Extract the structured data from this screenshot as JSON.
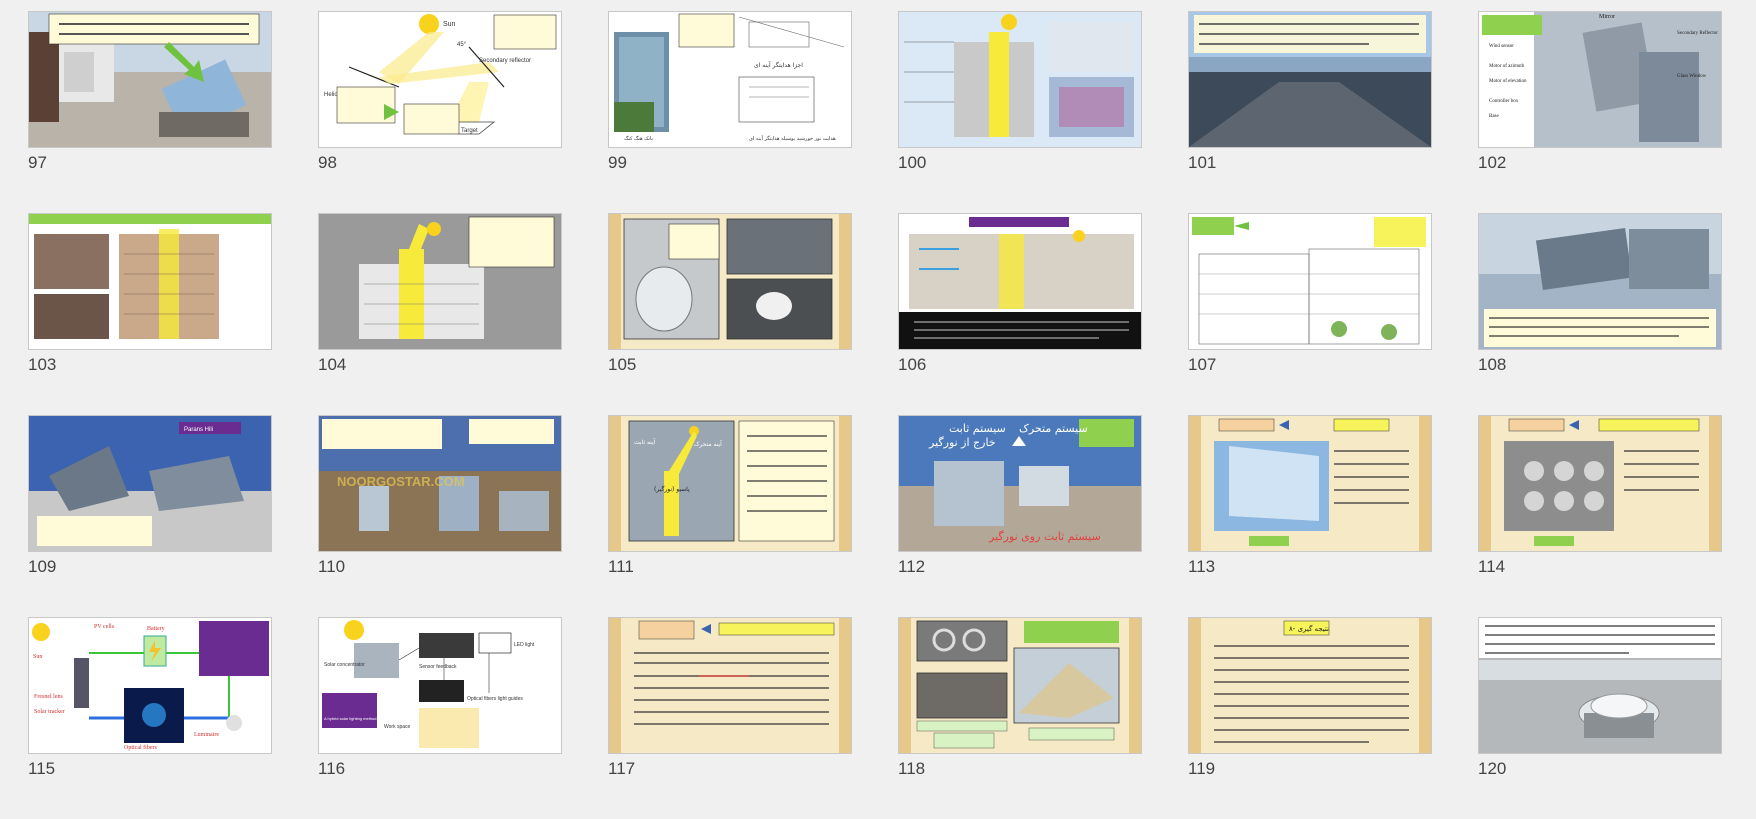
{
  "slides": [
    {
      "num": "97",
      "kind": "roof-heliostat"
    },
    {
      "num": "98",
      "kind": "diagram-sun",
      "labels": [
        "Sun",
        "Heliostat",
        "Secondary reflector",
        "Target",
        "45°"
      ]
    },
    {
      "num": "99",
      "kind": "building-drawing",
      "labels": [
        "اجزا هدایتگر آینه ای",
        "بانک هنگ کنگ",
        "هدایت نور خورشید بوسیله هدایتگر آینه ای"
      ]
    },
    {
      "num": "100",
      "kind": "diagram-building"
    },
    {
      "num": "101",
      "kind": "photo-roof-text"
    },
    {
      "num": "102",
      "kind": "heliostat-labels",
      "labels": [
        "Mirror",
        "Secondary Reflector",
        "Wind sensor",
        "Motor of azimuth",
        "Motor of elevation",
        "Glass Window",
        "Controller box",
        "Base"
      ]
    },
    {
      "num": "103",
      "kind": "building-photos"
    },
    {
      "num": "104",
      "kind": "section-yellow"
    },
    {
      "num": "105",
      "kind": "parchment-photos"
    },
    {
      "num": "106",
      "kind": "section-dark"
    },
    {
      "num": "107",
      "kind": "sketch"
    },
    {
      "num": "108",
      "kind": "facade-text"
    },
    {
      "num": "109",
      "kind": "heliostat-blue",
      "labels": [
        "Parans Hili"
      ]
    },
    {
      "num": "110",
      "kind": "roof-mirrors",
      "labels": [
        "NOORGOSTAR.COM"
      ]
    },
    {
      "num": "111",
      "kind": "parchment-mirror",
      "labels": [
        "آینه ثابت",
        "آینه متحرک",
        "پاسیو (نورگیر)"
      ]
    },
    {
      "num": "112",
      "kind": "fixed-moving",
      "labels": [
        "سیستم متحرک",
        "سیستم ثابت",
        "خارج از نورگیر",
        "سیستم ثابت روی نورگیر"
      ]
    },
    {
      "num": "113",
      "kind": "parchment-photo"
    },
    {
      "num": "114",
      "kind": "parchment-photo2"
    },
    {
      "num": "115",
      "kind": "pv-diagram",
      "labels": [
        "Sun",
        "PV cells",
        "Battery",
        "Fresnel lens",
        "Solar tracker",
        "Optical fibers",
        "Luminaire"
      ]
    },
    {
      "num": "116",
      "kind": "fiber-diagram",
      "labels": [
        "Solar concentrator",
        "Sensor feedback",
        "LED light",
        "Work space",
        "Optical fibers light guides",
        "A hybrid solar lighting method for daylighting"
      ]
    },
    {
      "num": "117",
      "kind": "parchment-text"
    },
    {
      "num": "118",
      "kind": "parchment-photos3"
    },
    {
      "num": "119",
      "kind": "parchment-text2",
      "labels": [
        "۸- نتیجه گیری"
      ]
    },
    {
      "num": "120",
      "kind": "dome"
    }
  ],
  "colors": {
    "parchment": "#f6e9c6",
    "parchment_edge": "#e6c98a",
    "green_label": "#8fd14f",
    "yellow_label": "#f7f35a",
    "purple_label": "#6b2c91",
    "sky_blue": "#3b63b0"
  }
}
